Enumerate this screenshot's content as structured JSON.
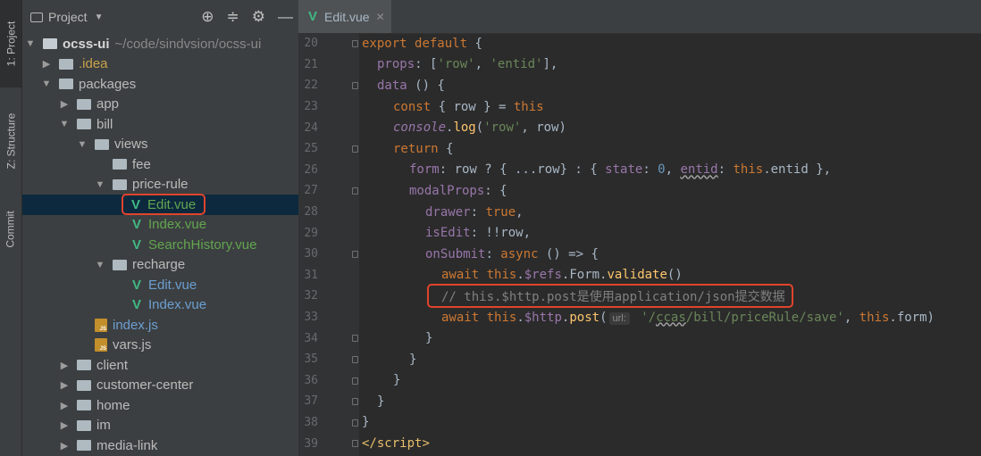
{
  "side_tabs": {
    "project": "1: Project",
    "structure": "Z: Structure",
    "commit": "Commit"
  },
  "project_panel": {
    "title": "Project",
    "tree": [
      {
        "label": "ocss-ui",
        "path": "~/code/sindvsion/ocss-ui"
      },
      {
        "label": ".idea"
      },
      {
        "label": "packages"
      },
      {
        "label": "app"
      },
      {
        "label": "bill"
      },
      {
        "label": "views"
      },
      {
        "label": "fee"
      },
      {
        "label": "price-rule"
      },
      {
        "label": "Edit.vue"
      },
      {
        "label": "Index.vue"
      },
      {
        "label": "SearchHistory.vue"
      },
      {
        "label": "recharge"
      },
      {
        "label": "Edit.vue"
      },
      {
        "label": "Index.vue"
      },
      {
        "label": "index.js"
      },
      {
        "label": "vars.js"
      },
      {
        "label": "client"
      },
      {
        "label": "customer-center"
      },
      {
        "label": "home"
      },
      {
        "label": "im"
      },
      {
        "label": "media-link"
      }
    ]
  },
  "editor": {
    "tab_label": "Edit.vue",
    "lines": [
      {
        "n": "20",
        "c": [
          "export",
          " ",
          "default",
          " {"
        ]
      },
      {
        "n": "21",
        "c": [
          "props",
          ": [",
          "'row'",
          ", ",
          "'entid'",
          "],"
        ]
      },
      {
        "n": "22",
        "c": [
          "data",
          " () {"
        ]
      },
      {
        "n": "23",
        "c": [
          "const",
          " { row } = ",
          "this"
        ]
      },
      {
        "n": "24",
        "c": [
          "console",
          ".",
          "log",
          "(",
          "'row'",
          ", row)"
        ]
      },
      {
        "n": "25",
        "c": [
          "return",
          " {"
        ]
      },
      {
        "n": "26",
        "c": [
          "form",
          ": row ? { ...row} : { ",
          "state",
          ": ",
          "0",
          ", ",
          "entid",
          ": ",
          "this",
          ".entid },"
        ]
      },
      {
        "n": "27",
        "c": [
          "modalProps",
          ": {"
        ]
      },
      {
        "n": "28",
        "c": [
          "drawer",
          ": ",
          "true",
          ","
        ]
      },
      {
        "n": "29",
        "c": [
          "isEdit",
          ": !!row,"
        ]
      },
      {
        "n": "30",
        "c": [
          "onSubmit",
          ": ",
          "async",
          " () => {"
        ]
      },
      {
        "n": "31",
        "c": [
          "await",
          " ",
          "this",
          ".",
          "$refs",
          ".Form.",
          "validate",
          "()"
        ]
      },
      {
        "n": "32",
        "c": [
          "// this.$http.post是使用application/json提交数据"
        ]
      },
      {
        "n": "33",
        "c": [
          "await",
          " ",
          "this",
          ".",
          "$http",
          ".",
          "post",
          "(",
          "url:",
          " ",
          "'/",
          "ccas",
          "/bill/priceRule/save'",
          ", ",
          "this",
          ".form)"
        ]
      },
      {
        "n": "34",
        "c": [
          "}"
        ]
      },
      {
        "n": "35",
        "c": [
          "}"
        ]
      },
      {
        "n": "36",
        "c": [
          "}"
        ]
      },
      {
        "n": "37",
        "c": [
          "}"
        ]
      },
      {
        "n": "38",
        "c": [
          "}"
        ]
      },
      {
        "n": "39",
        "c": [
          "</",
          "script",
          ">"
        ]
      }
    ]
  }
}
